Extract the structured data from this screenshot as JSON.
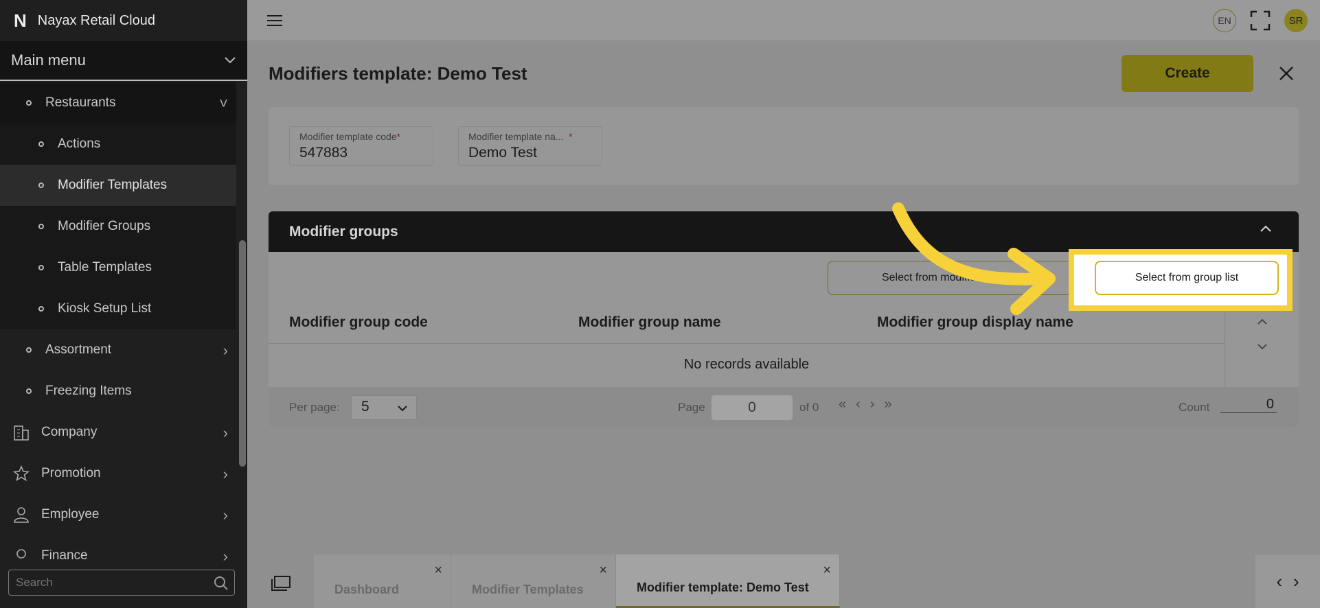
{
  "app": {
    "title": "Nayax Retail Cloud",
    "logo": "N"
  },
  "sidebar": {
    "main_menu_label": "Main menu",
    "items": [
      {
        "label": "Restaurants",
        "level": "l1",
        "type": "section",
        "chev": "˅"
      },
      {
        "label": "Actions",
        "level": "l2",
        "type": "sub"
      },
      {
        "label": "Modifier Templates",
        "level": "l2",
        "type": "active"
      },
      {
        "label": "Modifier Groups",
        "level": "l2",
        "type": "sub"
      },
      {
        "label": "Table Templates",
        "level": "l2",
        "type": "sub"
      },
      {
        "label": "Kiosk Setup List",
        "level": "l2",
        "type": "sub"
      },
      {
        "label": "Assortment",
        "level": "l1",
        "type": "normal",
        "chev": "›"
      },
      {
        "label": "Freezing Items",
        "level": "l1",
        "type": "normal"
      },
      {
        "label": "Company",
        "level": "top",
        "type": "normal",
        "chev": "›",
        "icon": "building-icon"
      },
      {
        "label": "Promotion",
        "level": "top",
        "type": "normal",
        "chev": "›",
        "icon": "star-icon"
      },
      {
        "label": "Employee",
        "level": "top",
        "type": "normal",
        "chev": "›",
        "icon": "person-icon"
      },
      {
        "label": "Finance",
        "level": "top",
        "type": "normal",
        "chev": "›",
        "icon": "finance-icon"
      }
    ],
    "search_placeholder": "Search"
  },
  "topbar": {
    "lang": "EN",
    "avatar_initials": "SR"
  },
  "page": {
    "title": "Modifiers template: Demo Test",
    "create_label": "Create"
  },
  "form": {
    "code_label": "Modifier template code",
    "code_value": "547883",
    "name_label": "Modifier template na...",
    "name_value": "Demo Test",
    "required_mark": "*"
  },
  "groups": {
    "header": "Modifier groups",
    "btn_template": "Select from modifier template",
    "btn_group_list": "Select from group list",
    "columns": [
      "Modifier group code",
      "Modifier group name",
      "Modifier group display name"
    ],
    "empty_text": "No records available"
  },
  "pager": {
    "per_page_label": "Per page:",
    "per_page_value": "5",
    "page_label": "Page",
    "page_value": "0",
    "of_label": "of 0",
    "count_label": "Count",
    "count_value": "0"
  },
  "tabs": [
    {
      "label": "Dashboard",
      "active": false
    },
    {
      "label": "Modifier Templates",
      "active": false
    },
    {
      "label": "Modifier template: Demo Test",
      "active": true
    }
  ],
  "colors": {
    "highlight": "#f7d13a",
    "brand": "#827a14"
  }
}
